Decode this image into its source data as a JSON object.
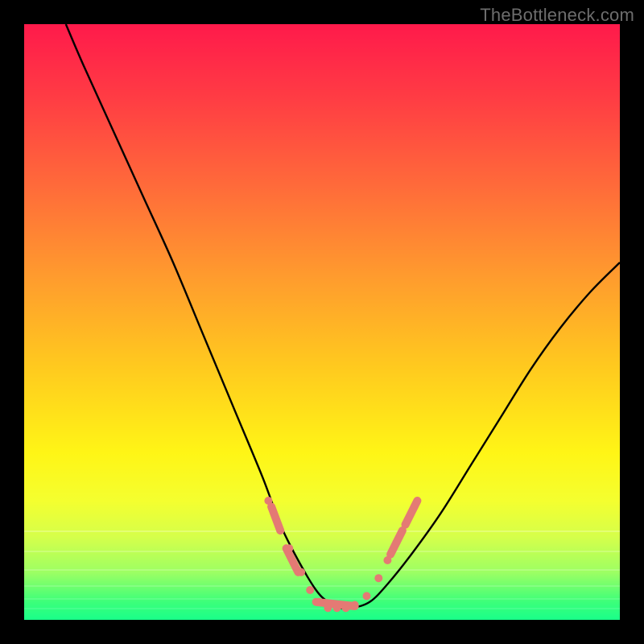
{
  "watermark": "TheBottleneck.com",
  "chart_data": {
    "type": "line",
    "title": "",
    "xlabel": "",
    "ylabel": "",
    "xlim": [
      0,
      100
    ],
    "ylim": [
      0,
      100
    ],
    "series": [
      {
        "name": "curve",
        "x": [
          7,
          10,
          15,
          20,
          25,
          30,
          35,
          40,
          43,
          46,
          49,
          51,
          53,
          55,
          58,
          61,
          65,
          70,
          75,
          80,
          85,
          90,
          95,
          100
        ],
        "y": [
          100,
          93,
          82,
          71,
          60,
          48,
          36,
          24,
          16,
          10,
          5,
          3,
          2,
          2,
          3,
          6,
          11,
          18,
          26,
          34,
          42,
          49,
          55,
          60
        ]
      }
    ],
    "markers": {
      "name": "dots",
      "color": "#e47a74",
      "x": [
        41,
        43,
        44.5,
        46.5,
        48,
        49.5,
        51,
        52.5,
        54,
        55.5,
        57.5,
        59.5,
        61,
        62.5,
        64,
        65.5
      ],
      "y": [
        20,
        15,
        12,
        8,
        5,
        3,
        2,
        2,
        2,
        2.5,
        4,
        7,
        10,
        13,
        16,
        19
      ]
    },
    "marker_segments": {
      "name": "thick-short-segments",
      "color": "#e47a74",
      "segments": [
        {
          "x": [
            41.5,
            43.0
          ],
          "y": [
            19,
            15
          ]
        },
        {
          "x": [
            44.0,
            46.0
          ],
          "y": [
            12,
            8
          ]
        },
        {
          "x": [
            49.0,
            55.5
          ],
          "y": [
            3,
            2.3
          ]
        },
        {
          "x": [
            61.5,
            63.5
          ],
          "y": [
            11,
            15
          ]
        },
        {
          "x": [
            64.0,
            66.0
          ],
          "y": [
            16,
            20
          ]
        }
      ]
    },
    "gradient_stops": [
      {
        "pos": 0,
        "color": "#ff1a4b"
      },
      {
        "pos": 12,
        "color": "#ff3b44"
      },
      {
        "pos": 27,
        "color": "#ff6a3a"
      },
      {
        "pos": 42,
        "color": "#ff9a2e"
      },
      {
        "pos": 57,
        "color": "#ffc81f"
      },
      {
        "pos": 72,
        "color": "#fff516"
      },
      {
        "pos": 80,
        "color": "#f4ff2f"
      },
      {
        "pos": 86,
        "color": "#d6ff4a"
      },
      {
        "pos": 92,
        "color": "#9dff63"
      },
      {
        "pos": 97,
        "color": "#3cff7a"
      },
      {
        "pos": 100,
        "color": "#1aff89"
      }
    ]
  }
}
